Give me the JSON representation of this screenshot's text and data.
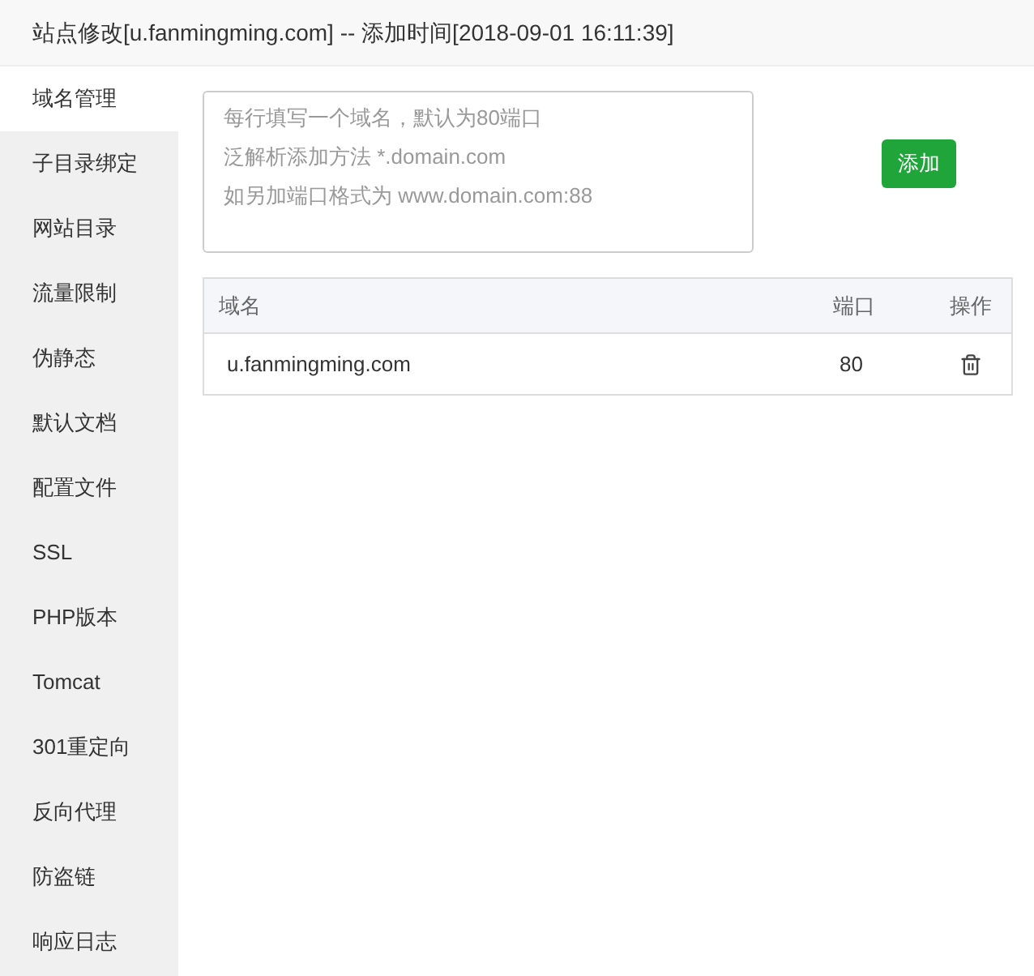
{
  "window": {
    "title": "站点修改[u.fanmingming.com] -- 添加时间[2018-09-01 16:11:39]"
  },
  "sidebar": {
    "items": [
      {
        "label": "域名管理",
        "selected": true
      },
      {
        "label": "子目录绑定",
        "selected": false
      },
      {
        "label": "网站目录",
        "selected": false
      },
      {
        "label": "流量限制",
        "selected": false
      },
      {
        "label": "伪静态",
        "selected": false
      },
      {
        "label": "默认文档",
        "selected": false
      },
      {
        "label": "配置文件",
        "selected": false
      },
      {
        "label": "SSL",
        "selected": false
      },
      {
        "label": "PHP版本",
        "selected": false
      },
      {
        "label": "Tomcat",
        "selected": false
      },
      {
        "label": "301重定向",
        "selected": false
      },
      {
        "label": "反向代理",
        "selected": false
      },
      {
        "label": "防盗链",
        "selected": false
      },
      {
        "label": "响应日志",
        "selected": false
      }
    ]
  },
  "domain_input": {
    "hint_lines": [
      "每行填写一个域名，默认为80端口",
      "泛解析添加方法 *.domain.com",
      "如另加端口格式为 www.domain.com:88"
    ]
  },
  "add_button": "添加",
  "table": {
    "columns": [
      "域名",
      "端口",
      "操作"
    ],
    "rows": [
      {
        "domain": "u.fanmingming.com",
        "port": "80"
      }
    ]
  }
}
